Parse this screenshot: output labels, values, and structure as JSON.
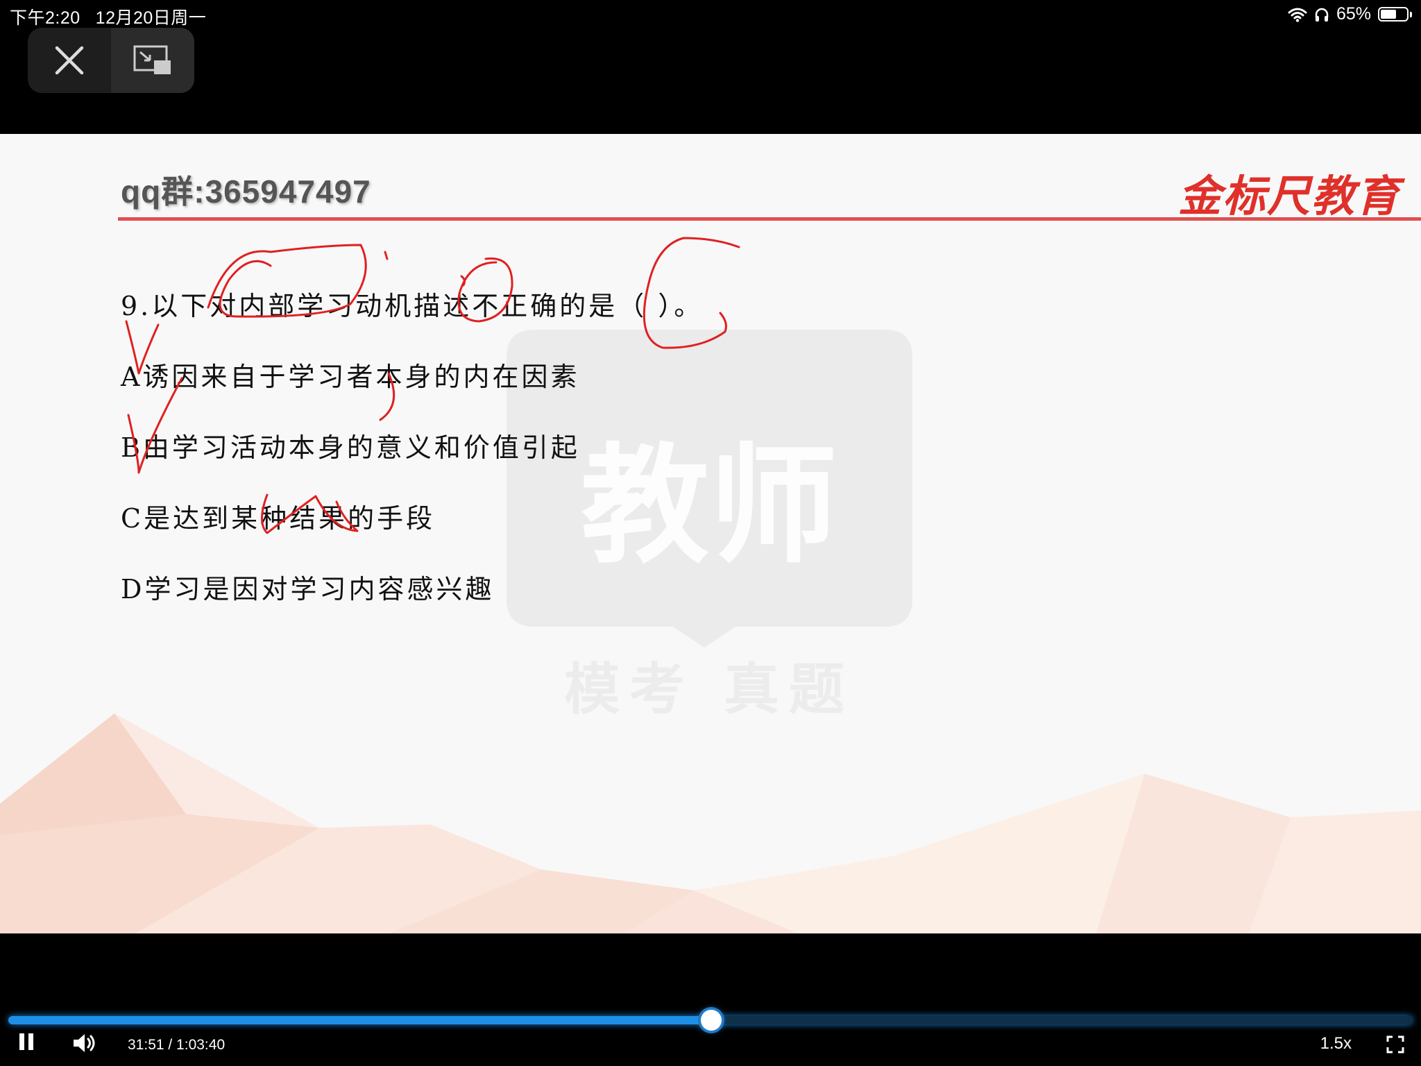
{
  "status_bar": {
    "time": "下午2:20",
    "date": "12月20日周一",
    "battery": "65%",
    "battery_level": 0.65
  },
  "icons": {
    "close": "close-icon",
    "pip": "picture-in-picture-icon",
    "wifi": "wifi-icon",
    "headphones": "headphones-icon",
    "battery": "battery-icon",
    "pause": "pause-icon",
    "volume": "volume-icon",
    "fullscreen": "fullscreen-icon"
  },
  "slide": {
    "qq_group": "qq群:365947497",
    "brand": "金标尺教育",
    "watermark_title": "教师",
    "watermark_subtitle": "模考 真题",
    "question": "9.以下对内部学习动机描述不正确的是（ ）。",
    "options": [
      "A诱因来自于学习者本身的内在因素",
      "B由学习活动本身的意义和价值引起",
      "C是达到某种结果的手段",
      "D学习是因对学习内容感兴趣"
    ],
    "handwritten_answer": "C"
  },
  "player": {
    "current_time": "31:51",
    "duration": "1:03:40",
    "time_display": "31:51 / 1:03:40",
    "progress": 0.5003,
    "speed": "1.5x"
  },
  "colors": {
    "accent": "#1e8fe6",
    "brand_red": "#e0302a",
    "ink": "#e02020"
  }
}
